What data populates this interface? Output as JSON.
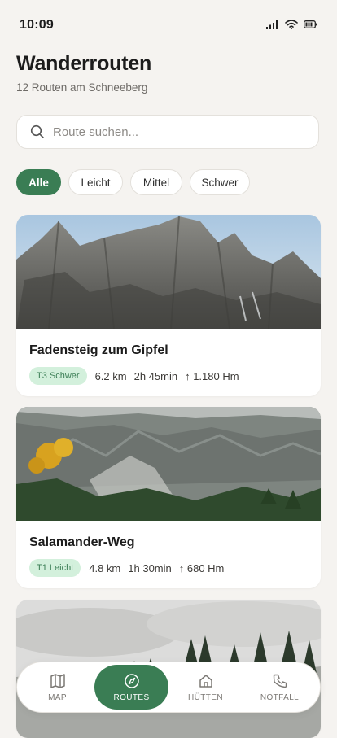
{
  "status": {
    "time": "10:09"
  },
  "header": {
    "title": "Wanderrouten",
    "subtitle": "12 Routen am Schneeberg"
  },
  "search": {
    "placeholder": "Route suchen...",
    "value": ""
  },
  "filters": [
    "Alle",
    "Leicht",
    "Mittel",
    "Schwer"
  ],
  "active_filter": "Alle",
  "routes": [
    {
      "title": "Fadensteig zum Gipfel",
      "difficulty": "T3 Schwer",
      "distance": "6.2 km",
      "duration": "2h 45min",
      "elevation": "↑ 1.180 Hm",
      "image": "rocky-peaks"
    },
    {
      "title": "Salamander-Weg",
      "difficulty": "T1 Leicht",
      "distance": "4.8 km",
      "duration": "1h 30min",
      "elevation": "↑ 680 Hm",
      "image": "forest-cliffs"
    },
    {
      "image": "misty-forest"
    }
  ],
  "nav": [
    {
      "label": "MAP",
      "icon": "map-icon"
    },
    {
      "label": "ROUTES",
      "icon": "compass-icon",
      "active": true
    },
    {
      "label": "HÜTTEN",
      "icon": "home-icon"
    },
    {
      "label": "NOTFALL",
      "icon": "phone-icon"
    }
  ],
  "colors": {
    "accent": "#3a7d54",
    "background": "#f5f3f0",
    "badge_bg": "#d3f0dc"
  }
}
